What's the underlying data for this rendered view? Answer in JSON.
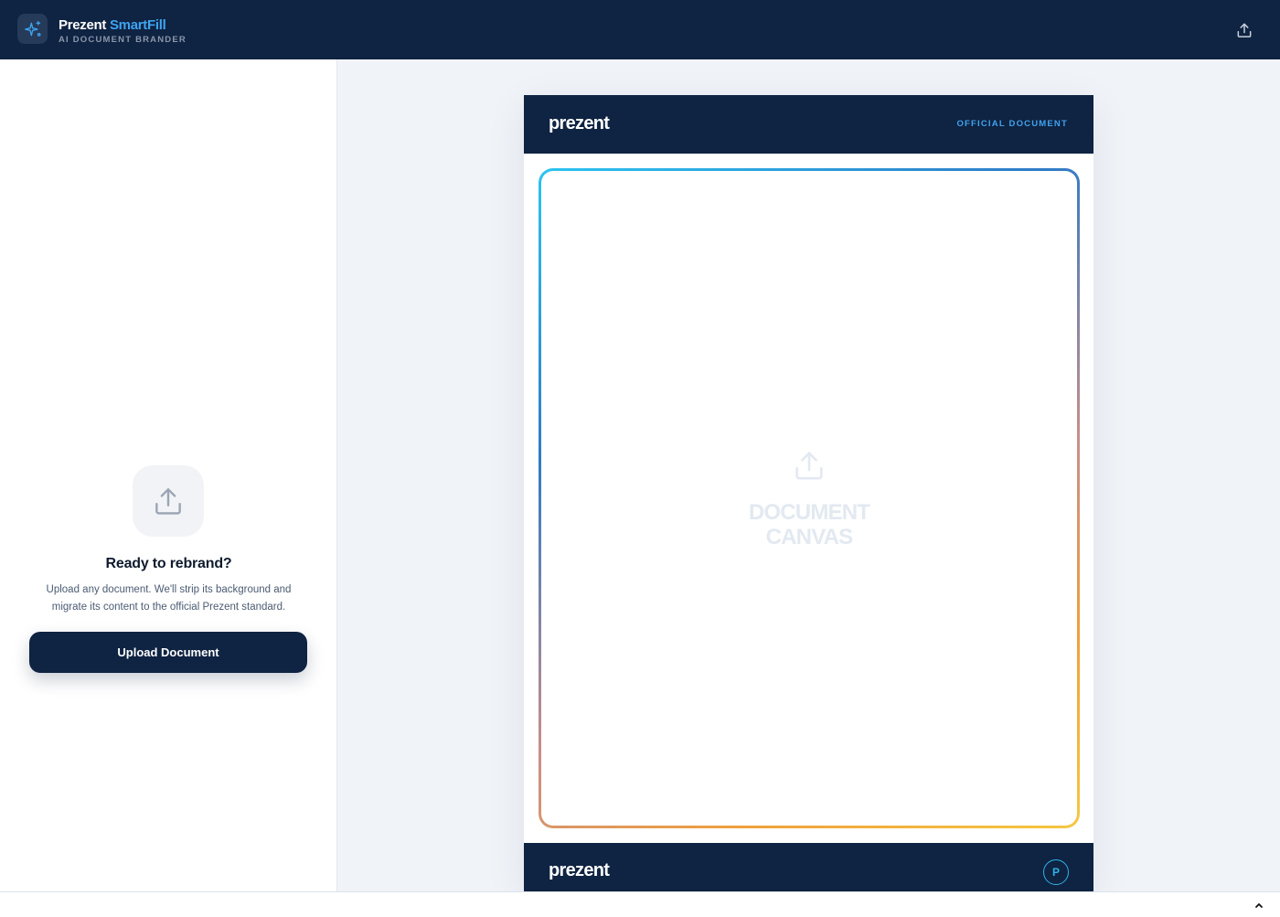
{
  "app": {
    "name": "Prezent",
    "product": "SmartFill",
    "subtitle": "AI DOCUMENT BRANDER"
  },
  "sidebar": {
    "heading": "Ready to rebrand?",
    "description": "Upload any document. We'll strip its background and migrate its content to the official Prezent standard.",
    "upload_button": "Upload Document"
  },
  "document": {
    "header_logo": "prezent",
    "header_tag": "OFFICIAL DOCUMENT",
    "canvas_line1": "DOCUMENT",
    "canvas_line2": "CANVAS",
    "footer_logo": "prezent",
    "footer_badge": "P"
  },
  "colors": {
    "navy": "#0f2342",
    "accent_blue": "#3fa3f0",
    "cyan": "#2bb3ea",
    "gradient": [
      "#2bc4f0",
      "#2e7bc7",
      "#c98e8a",
      "#f0a03c",
      "#f5c842"
    ]
  },
  "icons": {
    "app_logo": "sparkles-icon",
    "export": "upload-icon",
    "upload_tile": "upload-icon",
    "canvas": "upload-icon",
    "footer_caret": "chevron-up-icon"
  }
}
